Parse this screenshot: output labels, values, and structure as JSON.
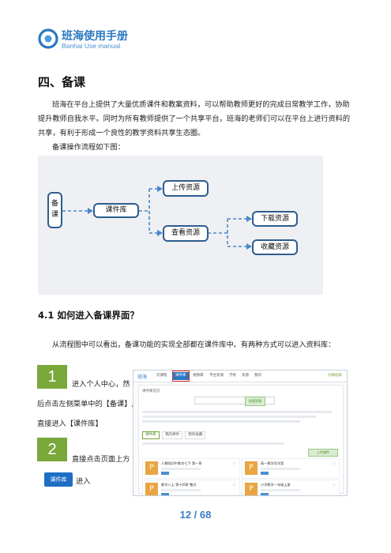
{
  "header": {
    "logo_title": "班海使用手册",
    "logo_subtitle": "Banhai Use manual"
  },
  "section": {
    "title": "四、备课",
    "para1": "班海在平台上提供了大量优质课件和教案资料，可以帮助教师更好的完成日常教学工作，协助提升教师自我水平。同时为所有教师提供了一个共享平台，班海的老师们可以在平台上进行资料的共享，有利于形成一个良性的教学资料共享生态圈。",
    "para2": "备课操作流程如下图："
  },
  "flowchart": {
    "root": "备课",
    "library": "课件库",
    "upload": "上传资源",
    "view": "查看资源",
    "download": "下载资源",
    "collect": "收藏资源",
    "line_color": "#4a86c8",
    "node_border": "#2d5d8f"
  },
  "subsection": {
    "title": "4.1 如何进入备课界面？",
    "intro": "从流程图中可以看出，备课功能的实现全部都在课件库中。有两种方式可以进入资料库："
  },
  "steps": [
    {
      "num": "1",
      "line1": "进入个人中心，然",
      "line2": "后点击左侧菜单中的【备课】,",
      "line3": "直接进入【课件库】"
    },
    {
      "num": "2",
      "line1": "直接点击页面上方",
      "button": "课件库",
      "line2": "进入"
    }
  ],
  "screenshot": {
    "logo": "班海",
    "nav": [
      "云课程",
      "课件库",
      "视频库",
      "平台资源",
      "学校",
      "资源",
      "我的"
    ],
    "active_nav": "课件库",
    "right_text": "切换班级",
    "crumb": "课件库首页",
    "search_btn": "检索资源",
    "tabs": [
      "课件库",
      "我的课件",
      "我的收藏"
    ],
    "upload_btn": "上传课件",
    "items": [
      "人教版初中数学七下 第一章",
      "高一数学导学案",
      "数学八上 第十四章 整式",
      "小学数学一年级上册"
    ]
  },
  "footer": {
    "page": "12 / 68"
  },
  "colors": {
    "brand": "#2a78c2",
    "step_green": "#7aa83a",
    "page_number": "#3b7fc4"
  }
}
